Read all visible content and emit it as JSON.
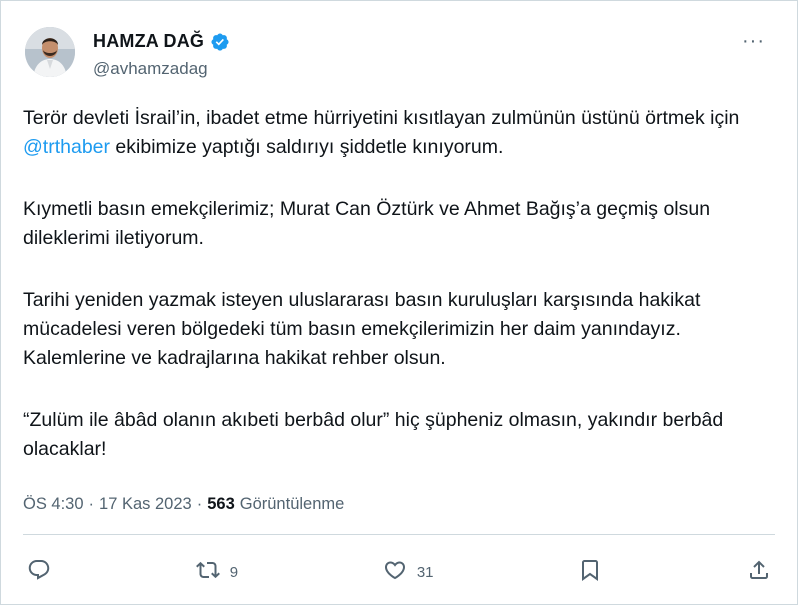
{
  "author": {
    "name": "HAMZA DAĞ",
    "handle": "@avhamzadag",
    "verified": true,
    "verified_color": "#1d9bf0"
  },
  "tweet": {
    "paragraphs": [
      {
        "before": "Terör devleti İsrail’in, ibadet etme hürriyetini kısıtlayan zulmünün üstünü örtmek için ",
        "mention": "@trthaber",
        "after": " ekibimize yaptığı saldırıyı şiddetle kınıyorum."
      },
      {
        "text": "Kıymetli basın emekçilerimiz; Murat Can Öztürk ve Ahmet Bağış’a geçmiş olsun dileklerimi iletiyorum."
      },
      {
        "text": "Tarihi yeniden yazmak isteyen uluslararası basın kuruluşları karşısında hakikat mücadelesi veren bölgedeki tüm basın emekçilerimizin her daim yanındayız. Kalemlerine ve kadrajlarına hakikat rehber olsun."
      },
      {
        "text": "“Zulüm ile âbâd olanın akıbeti berbâd olur” hiç şüpheniz olmasın, yakındır berbâd olacaklar!"
      }
    ]
  },
  "meta": {
    "time": "ÖS 4:30",
    "date": "17 Kas 2023",
    "sep": "·",
    "views_count": "563",
    "views_label": "Görüntülenme"
  },
  "actions": {
    "reply_icon": "reply-icon",
    "retweet_icon": "retweet-icon",
    "retweet_count": "9",
    "like_icon": "heart-icon",
    "like_count": "31",
    "bookmark_icon": "bookmark-icon",
    "share_icon": "share-icon"
  },
  "more_label": "···",
  "colors": {
    "text": "#0f1419",
    "secondary": "#536471",
    "link": "#1d9bf0",
    "border": "#cfd9de"
  }
}
